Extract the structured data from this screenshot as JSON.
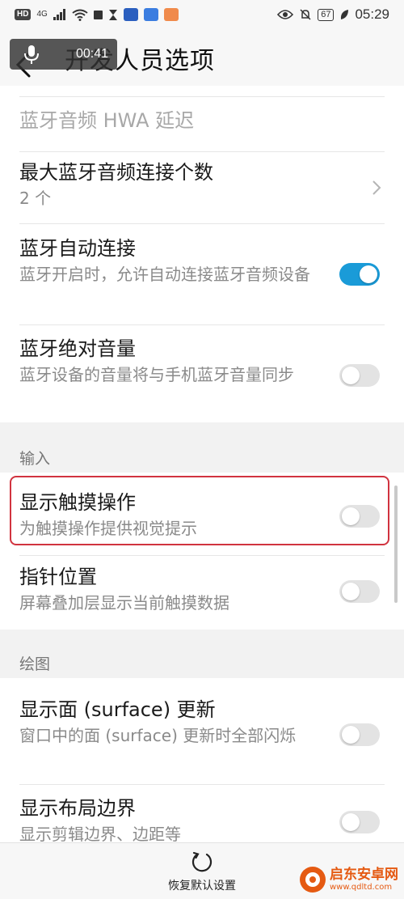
{
  "status_bar": {
    "hd": "HD",
    "network": "4G",
    "battery": "67",
    "time": "05:29"
  },
  "recording": {
    "timer": "00:41"
  },
  "header": {
    "title": "开发人员选项"
  },
  "settings": {
    "hwa_delay": {
      "title": "蓝牙音频 HWA 延迟"
    },
    "max_connections": {
      "title": "最大蓝牙音频连接个数",
      "value": "2 个"
    },
    "auto_connect": {
      "title": "蓝牙自动连接",
      "subtitle": "蓝牙开启时，允许自动连接蓝牙音频设备",
      "on": true
    },
    "absolute_volume": {
      "title": "蓝牙绝对音量",
      "subtitle": "蓝牙设备的音量将与手机蓝牙音量同步",
      "on": false
    },
    "section_input": "输入",
    "show_touches": {
      "title": "显示触摸操作",
      "subtitle": "为触摸操作提供视觉提示",
      "on": false
    },
    "pointer_location": {
      "title": "指针位置",
      "subtitle": "屏幕叠加层显示当前触摸数据",
      "on": false
    },
    "section_drawing": "绘图",
    "surface_updates": {
      "title": "显示面 (surface) 更新",
      "subtitle": "窗口中的面 (surface) 更新时全部闪烁",
      "on": false
    },
    "layout_bounds": {
      "title": "显示布局边界",
      "subtitle": "显示剪辑边界、边距等",
      "on": false
    }
  },
  "bottom_bar": {
    "reset_label": "恢复默认设置"
  },
  "watermark": {
    "brand": "启东安卓网",
    "url": "www.qdltd.com"
  },
  "colors": {
    "toggle_on": "#1a9bd8",
    "highlight": "#d1333f",
    "watermark": "#e55a12"
  }
}
